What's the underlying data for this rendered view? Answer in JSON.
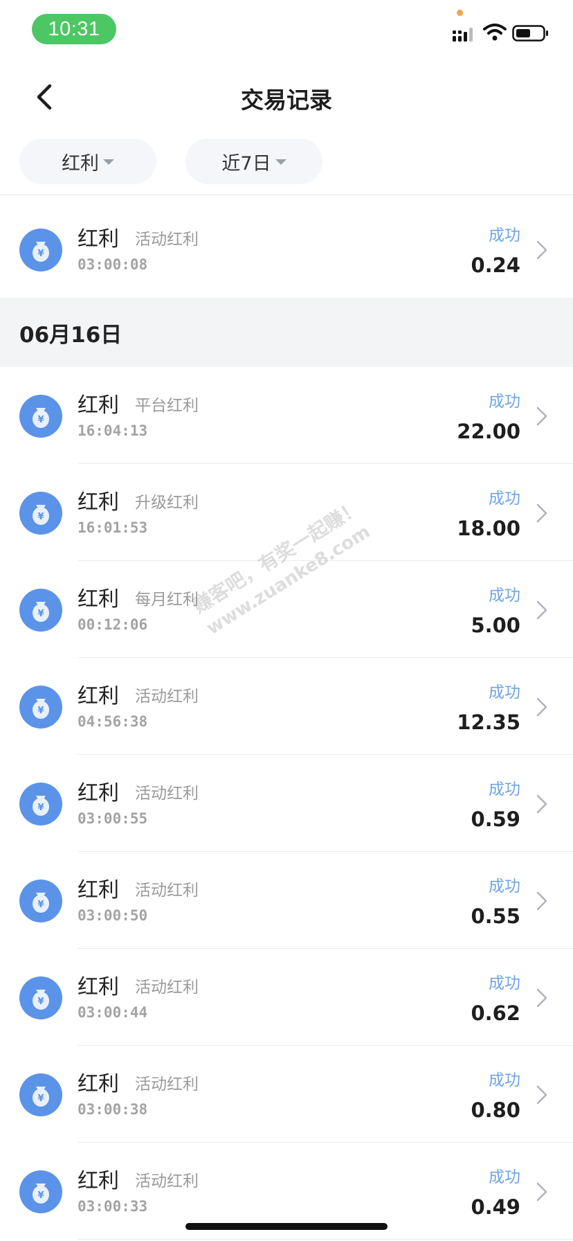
{
  "status_bar": {
    "time": "10:31",
    "icons": [
      "signal-icon",
      "wifi-icon",
      "battery-icon"
    ]
  },
  "nav": {
    "title": "交易记录",
    "back_icon": "chevron-left-icon"
  },
  "filters": {
    "type": "红利",
    "period": "近7日"
  },
  "colors": {
    "status": "#6fa4e5",
    "coin": "#5b93e8",
    "time_pill": "#4cc764"
  },
  "top_item": {
    "title": "红利",
    "subtitle": "活动红利",
    "time": "03:00:08",
    "status": "成功",
    "amount": "0.24"
  },
  "group": {
    "date": "06月16日",
    "items": [
      {
        "title": "红利",
        "subtitle": "平台红利",
        "time": "16:04:13",
        "status": "成功",
        "amount": "22.00"
      },
      {
        "title": "红利",
        "subtitle": "升级红利",
        "time": "16:01:53",
        "status": "成功",
        "amount": "18.00"
      },
      {
        "title": "红利",
        "subtitle": "每月红利",
        "time": "00:12:06",
        "status": "成功",
        "amount": "5.00"
      },
      {
        "title": "红利",
        "subtitle": "活动红利",
        "time": "04:56:38",
        "status": "成功",
        "amount": "12.35"
      },
      {
        "title": "红利",
        "subtitle": "活动红利",
        "time": "03:00:55",
        "status": "成功",
        "amount": "0.59"
      },
      {
        "title": "红利",
        "subtitle": "活动红利",
        "time": "03:00:50",
        "status": "成功",
        "amount": "0.55"
      },
      {
        "title": "红利",
        "subtitle": "活动红利",
        "time": "03:00:44",
        "status": "成功",
        "amount": "0.62"
      },
      {
        "title": "红利",
        "subtitle": "活动红利",
        "time": "03:00:38",
        "status": "成功",
        "amount": "0.80"
      },
      {
        "title": "红利",
        "subtitle": "活动红利",
        "time": "03:00:33",
        "status": "成功",
        "amount": "0.49"
      }
    ]
  },
  "watermark": {
    "line1": "赚客吧，有奖一起赚！",
    "line2": "www.zuanke8.com"
  }
}
